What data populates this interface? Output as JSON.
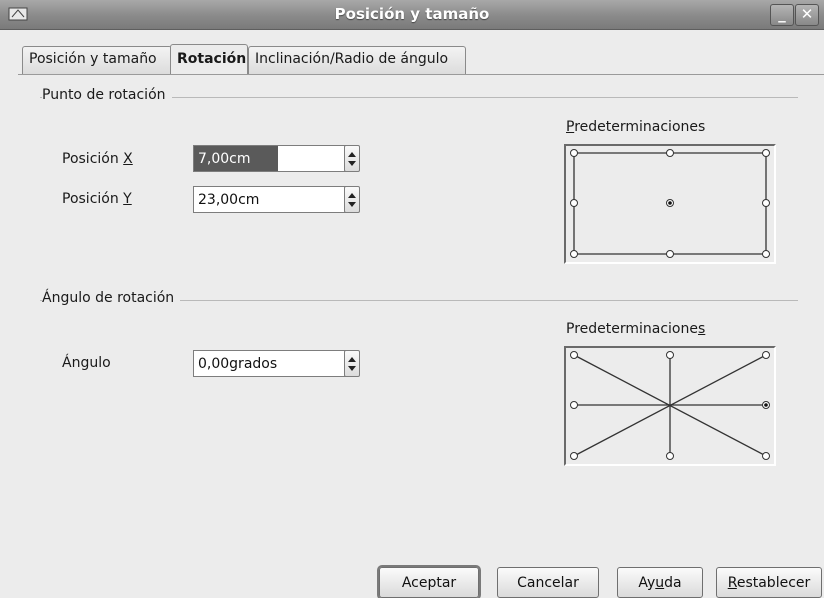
{
  "window": {
    "title": "Posición y tamaño",
    "minimize_glyph": "_",
    "close_glyph": "✕",
    "icon": "app-document-icon"
  },
  "tabs": [
    {
      "label": "Posición y tamaño",
      "active": false
    },
    {
      "label": "Rotación",
      "active": true
    },
    {
      "label": "Inclinación/Radio de ángulo",
      "active": false
    }
  ],
  "rotation_point": {
    "group_label": "Punto de rotación",
    "pos_x": {
      "label_prefix": "Posición ",
      "label_key": "X",
      "value": "7,00cm"
    },
    "pos_y": {
      "label_prefix": "Posición ",
      "label_key": "Y",
      "value": "23,00cm"
    },
    "presets": {
      "label_key": "P",
      "label_rest": "redeterminaciones",
      "selected": "center"
    }
  },
  "rotation_angle": {
    "group_label": "Ángulo de rotación",
    "angle": {
      "label": "Ángulo",
      "value": "0,00grados"
    },
    "presets": {
      "label_start": "Predeterminacione",
      "label_key": "s",
      "selected": "right"
    }
  },
  "buttons": {
    "ok": "Aceptar",
    "cancel": "Cancelar",
    "help_pre": "Ay",
    "help_key": "u",
    "help_post": "da",
    "reset_key": "R",
    "reset_rest": "establecer"
  }
}
